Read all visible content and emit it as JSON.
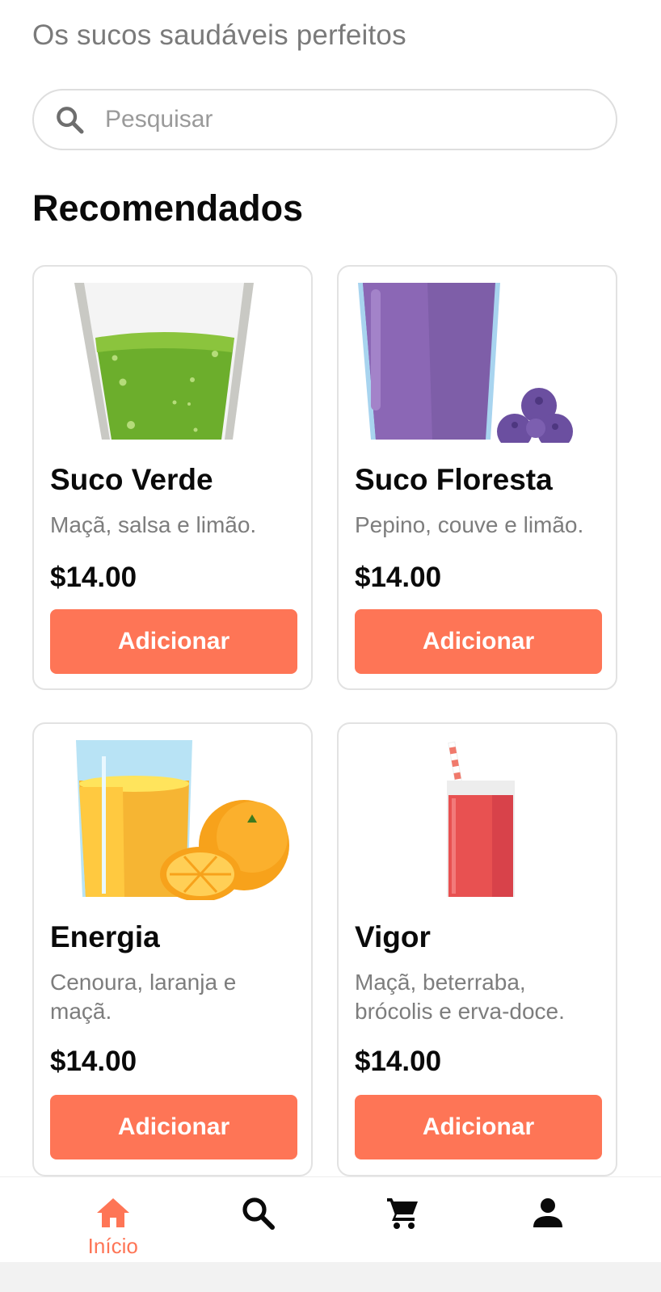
{
  "header": {
    "subtitle": "Os sucos saudáveis perfeitos"
  },
  "search": {
    "placeholder": "Pesquisar",
    "icon": "search-icon"
  },
  "section": {
    "title": "Recomendados"
  },
  "products": [
    {
      "name": "Suco Verde",
      "description": "Maçã, salsa e limão.",
      "price": "$14.00",
      "button": "Adicionar",
      "image": "green-juice-glass"
    },
    {
      "name": "Suco Floresta",
      "description": "Pepino, couve e limão.",
      "price": "$14.00",
      "button": "Adicionar",
      "image": "purple-juice-blueberries"
    },
    {
      "name": "Energia",
      "description": "Cenoura, laranja e maçã.",
      "price": "$14.00",
      "button": "Adicionar",
      "image": "orange-juice-oranges"
    },
    {
      "name": "Vigor",
      "description": "Maçã, beterraba, brócolis e erva-doce.",
      "price": "$14.00",
      "button": "Adicionar",
      "image": "red-juice-straw"
    }
  ],
  "nav": {
    "items": [
      {
        "label": "Início",
        "icon": "home-icon",
        "active": true
      },
      {
        "label": "",
        "icon": "search-icon",
        "active": false
      },
      {
        "label": "",
        "icon": "cart-icon",
        "active": false
      },
      {
        "label": "",
        "icon": "profile-icon",
        "active": false
      }
    ]
  },
  "colors": {
    "accent": "#fe7556",
    "muted_text": "#7d7d7d",
    "border": "#e2e2e2"
  }
}
